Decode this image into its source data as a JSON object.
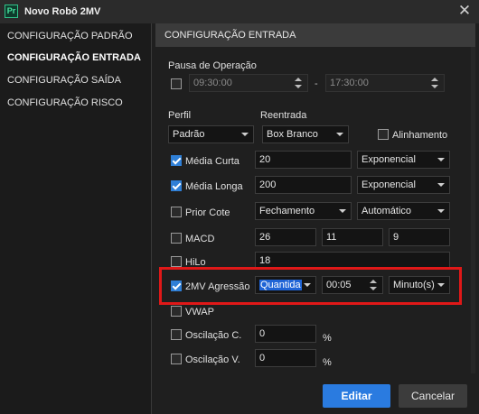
{
  "window": {
    "title": "Novo Robô 2MV",
    "app_icon": "Pr",
    "close_glyph": "✕"
  },
  "sidebar": {
    "items": [
      {
        "label": "CONFIGURAÇÃO PADRÃO",
        "active": false
      },
      {
        "label": "CONFIGURAÇÃO ENTRADA",
        "active": true
      },
      {
        "label": "CONFIGURAÇÃO SAÍDA",
        "active": false
      },
      {
        "label": "CONFIGURAÇÃO RISCO",
        "active": false
      }
    ]
  },
  "section": {
    "title": "CONFIGURAÇÃO ENTRADA"
  },
  "pausa": {
    "label": "Pausa de Operação",
    "checked": false,
    "start": "09:30:00",
    "separator": "-",
    "end": "17:30:00"
  },
  "perfil": {
    "label": "Perfil",
    "value": "Padrão"
  },
  "reentrada": {
    "label": "Reentrada",
    "value": "Box Branco"
  },
  "alinhamento": {
    "label": "Alinhamento",
    "checked": false
  },
  "media_curta": {
    "label": "Média Curta",
    "checked": true,
    "value": "20",
    "type": "Exponencial"
  },
  "media_longa": {
    "label": "Média Longa",
    "checked": true,
    "value": "200",
    "type": "Exponencial"
  },
  "prior_cote": {
    "label": "Prior Cote",
    "checked": false,
    "value": "Fechamento",
    "mode": "Automático"
  },
  "macd": {
    "label": "MACD",
    "checked": false,
    "v1": "26",
    "v2": "11",
    "v3": "9"
  },
  "hilo": {
    "label": "HiLo",
    "checked": false,
    "value": "18"
  },
  "agressao": {
    "label": "2MV Agressão",
    "checked": true,
    "type": "Quantida",
    "time": "00:05",
    "unit": "Minuto(s)"
  },
  "vwap": {
    "label": "VWAP",
    "checked": false
  },
  "oscilacao_c": {
    "label": "Oscilação C.",
    "checked": false,
    "value": "0",
    "unit": "%"
  },
  "oscilacao_v": {
    "label": "Oscilação V.",
    "checked": false,
    "value": "0",
    "unit": "%"
  },
  "buttons": {
    "edit": "Editar",
    "cancel": "Cancelar"
  },
  "colors": {
    "accent": "#2a7be0",
    "highlight": "#e01818",
    "background": "#1f1f1f"
  }
}
